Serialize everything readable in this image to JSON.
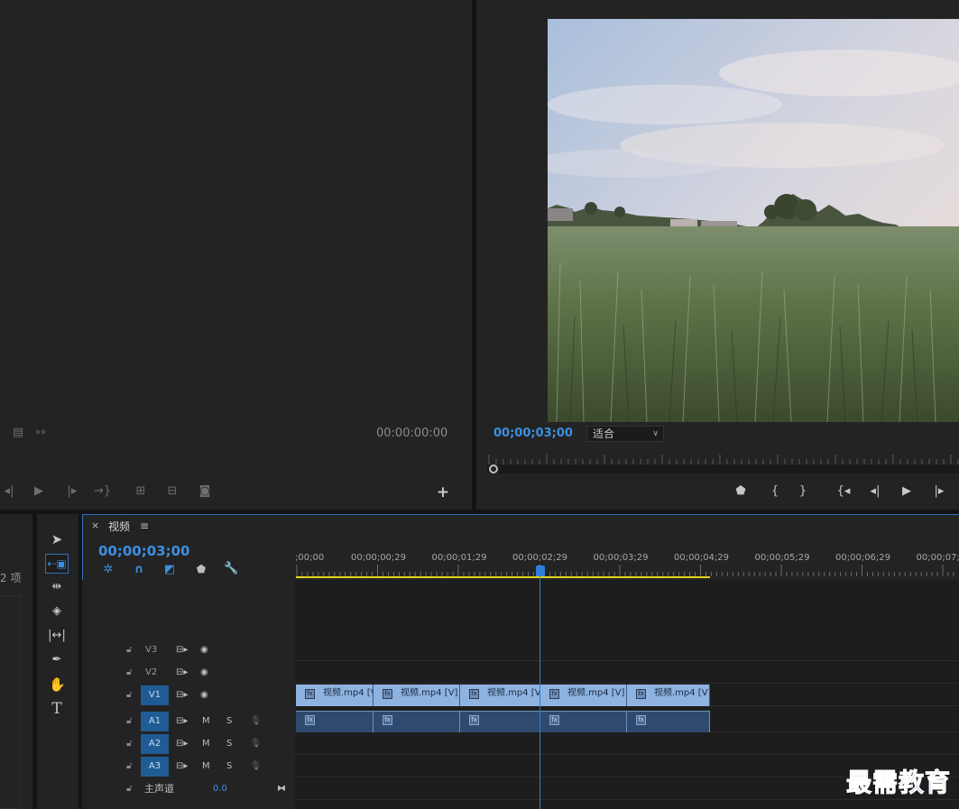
{
  "source_monitor": {
    "timecode": "00:00:00:00"
  },
  "program_monitor": {
    "timecode": "00;00;03;00",
    "fit_label": "适合"
  },
  "project_panel": {
    "item_count": "2 项"
  },
  "timeline": {
    "tab_label": "视频",
    "close_glyph": "×",
    "menu_glyph": "≡",
    "timecode": "00;00;03;00",
    "ruler_labels": [
      ";00;00",
      "00;00;00;29",
      "00;00;01;29",
      "00;00;02;29",
      "00;00;03;29",
      "00;00;04;29",
      "00;00;05;29",
      "00;00;06;29",
      "00;00;07;"
    ],
    "tracks": {
      "v3": "V3",
      "v2": "V2",
      "v1": "V1",
      "a1": "A1",
      "a2": "A2",
      "a3": "A3",
      "m": "M",
      "s": "S"
    },
    "master": {
      "label": "主声道",
      "value": "0.0"
    },
    "clip_label": "视频.mp4 [V]"
  },
  "watermark": "最需教育",
  "colors": {
    "accent_blue": "#3d8fe0",
    "target_on": "#1f5c95",
    "video_clip": "#8fb3e0",
    "work_area": "#e4d21b"
  },
  "icons": [
    "export-frame-icon",
    "play-icon",
    "step-back-icon",
    "step-forward-icon",
    "wrench-icon",
    "magnet-icon",
    "marker-icon",
    "lock-icon",
    "eye-icon",
    "mic-icon",
    "selection-tool-icon",
    "ripple-edit-tool-icon",
    "razor-tool-icon",
    "pen-tool-icon",
    "hand-tool-icon",
    "type-tool-icon"
  ]
}
